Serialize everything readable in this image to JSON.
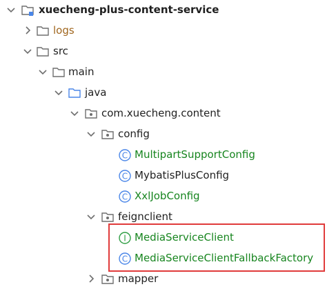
{
  "tree": {
    "root": {
      "label": "xuecheng-plus-content-service",
      "icon": "module-folder-icon"
    },
    "logs": {
      "label": "logs",
      "icon": "folder-icon"
    },
    "src": {
      "label": "src",
      "icon": "folder-icon"
    },
    "main": {
      "label": "main",
      "icon": "folder-icon"
    },
    "java": {
      "label": "java",
      "icon": "source-folder-icon"
    },
    "package": {
      "label": "com.xuecheng.content",
      "icon": "package-icon"
    },
    "config": {
      "label": "config",
      "icon": "package-icon"
    },
    "config_items": [
      {
        "label": "MultipartSupportConfig",
        "icon": "class-icon"
      },
      {
        "label": "MybatisPlusConfig",
        "icon": "class-icon"
      },
      {
        "label": "XxlJobConfig",
        "icon": "class-icon"
      }
    ],
    "feignclient": {
      "label": "feignclient",
      "icon": "package-icon"
    },
    "feign_items": [
      {
        "label": "MediaServiceClient",
        "icon": "interface-icon"
      },
      {
        "label": "MediaServiceClientFallbackFactory",
        "icon": "class-icon"
      }
    ],
    "mapper": {
      "label": "mapper",
      "icon": "package-icon"
    }
  },
  "colors": {
    "folder": "#6e6e6e",
    "source_folder": "#4a86e8",
    "class_icon": "#4a86e8",
    "interface_icon": "#2f9e44",
    "green_text": "#17851f",
    "orange_text": "#a0661e",
    "highlight": "#e03a3a"
  }
}
